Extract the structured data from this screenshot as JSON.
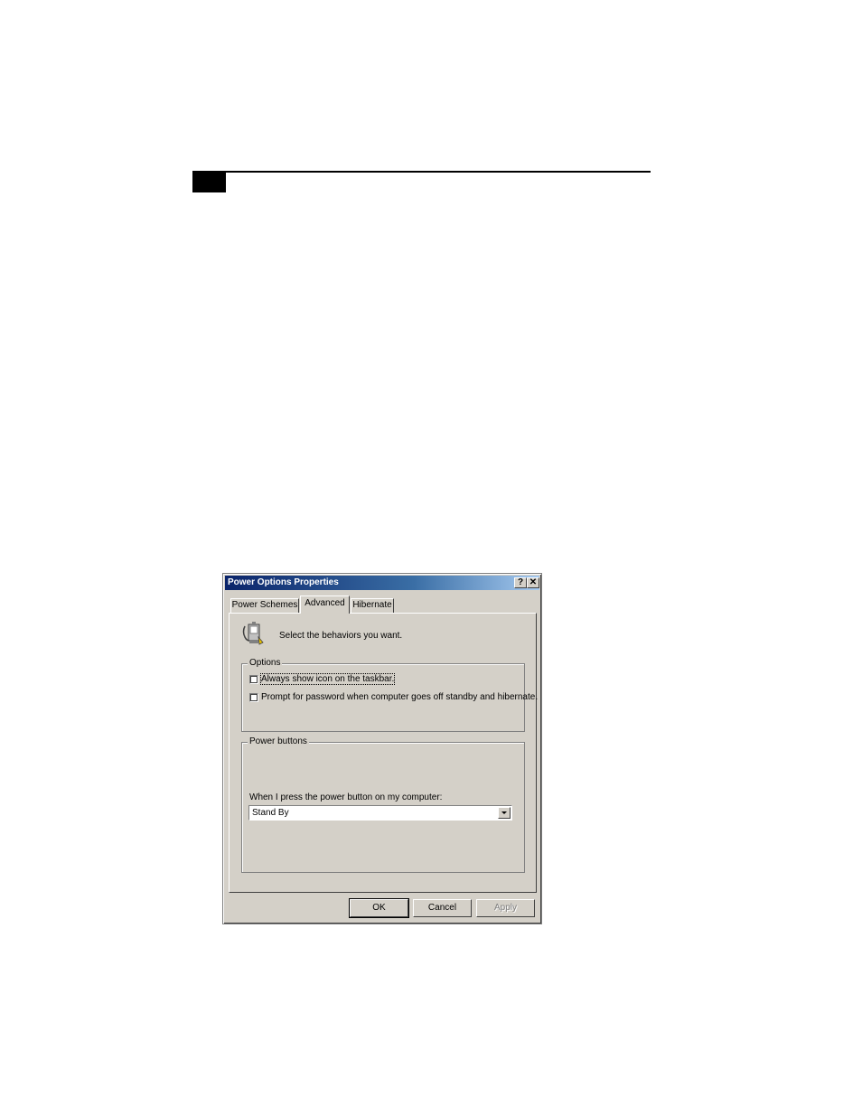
{
  "dialog": {
    "title": "Power Options Properties",
    "title_buttons": {
      "help": "?",
      "close": "✕"
    },
    "tabs": [
      {
        "label": "Power Schemes",
        "active": false
      },
      {
        "label": "Advanced",
        "active": true
      },
      {
        "label": "Hibernate",
        "active": false
      }
    ],
    "intro_text": "Select the behaviors you want.",
    "options_group": {
      "legend": "Options",
      "checkboxes": [
        {
          "label": "Always show icon on the taskbar.",
          "checked": false
        },
        {
          "label": "Prompt for password when computer goes off standby and hibernate.",
          "checked": false
        }
      ]
    },
    "power_buttons_group": {
      "legend": "Power buttons",
      "prompt": "When I press the power button on my computer:",
      "selected_value": "Stand By"
    },
    "buttons": {
      "ok": "OK",
      "cancel": "Cancel",
      "apply": "Apply"
    },
    "colors": {
      "face": "#d4d0c8",
      "title_start": "#0a246a",
      "title_end": "#a6caf0"
    }
  }
}
